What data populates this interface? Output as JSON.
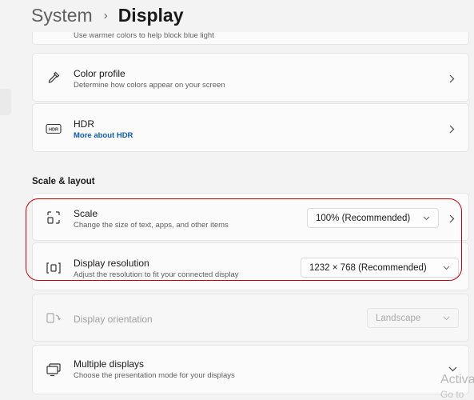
{
  "breadcrumb": {
    "parent": "System",
    "separator": "›",
    "current": "Display"
  },
  "cards": {
    "night_light": {
      "subtitle": "Use warmer colors to help block blue light"
    },
    "color_profile": {
      "title": "Color profile",
      "subtitle": "Determine how colors appear on your screen",
      "icon": "eyedropper-icon"
    },
    "hdr": {
      "title": "HDR",
      "link": "More about HDR",
      "icon": "hdr-icon"
    },
    "scale": {
      "title": "Scale",
      "subtitle": "Change the size of text, apps, and other items",
      "value": "100% (Recommended)",
      "icon": "scale-icon"
    },
    "resolution": {
      "title": "Display resolution",
      "subtitle": "Adjust the resolution to fit your connected display",
      "value": "1232 × 768 (Recommended)",
      "icon": "resolution-icon"
    },
    "orientation": {
      "title": "Display orientation",
      "value": "Landscape",
      "icon": "orientation-icon"
    },
    "multiple_displays": {
      "title": "Multiple displays",
      "subtitle": "Choose the presentation mode for your displays",
      "icon": "multiple-displays-icon"
    }
  },
  "section": {
    "scale_layout": "Scale & layout"
  },
  "watermark": {
    "line1": "Activa",
    "line2": "Go to"
  },
  "colors": {
    "highlight": "#c8000a",
    "link": "#0a5cb8",
    "background": "#f3f3f3",
    "card": "#fbfbfb"
  }
}
